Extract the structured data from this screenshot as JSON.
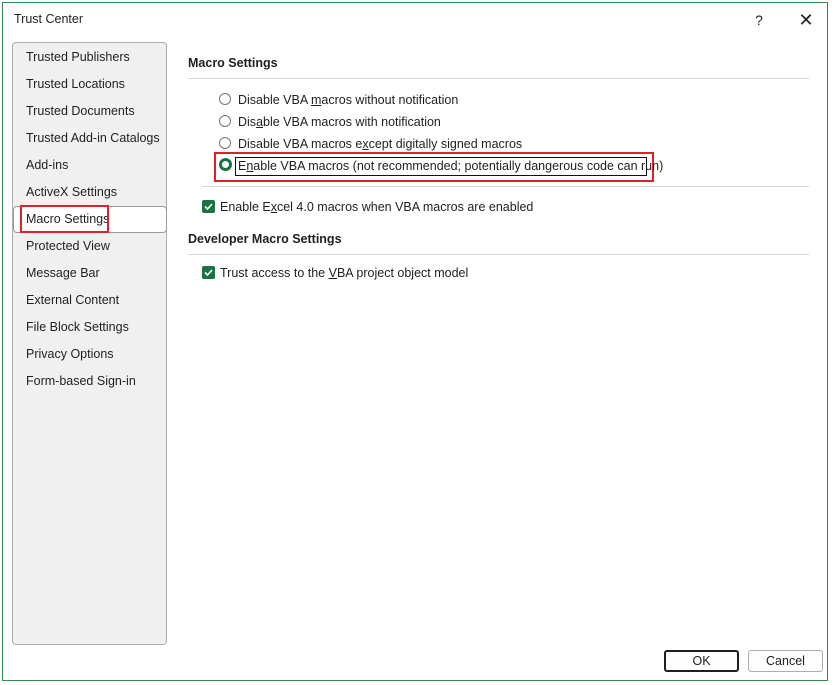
{
  "window": {
    "title": "Trust Center",
    "help_label": "?",
    "close_label": "✕"
  },
  "sidebar": {
    "items": [
      {
        "label": "Trusted Publishers"
      },
      {
        "label": "Trusted Locations"
      },
      {
        "label": "Trusted Documents"
      },
      {
        "label": "Trusted Add-in Catalogs"
      },
      {
        "label": "Add-ins"
      },
      {
        "label": "ActiveX Settings"
      },
      {
        "label": "Macro Settings",
        "selected": true
      },
      {
        "label": "Protected View"
      },
      {
        "label": "Message Bar"
      },
      {
        "label": "External Content"
      },
      {
        "label": "File Block Settings"
      },
      {
        "label": "Privacy Options"
      },
      {
        "label": "Form-based Sign-in"
      }
    ]
  },
  "macro_settings": {
    "title": "Macro Settings",
    "options": {
      "opt1": {
        "pre": "Disable VBA ",
        "u": "m",
        "post": "acros without notification",
        "selected": false
      },
      "opt2": {
        "pre": "Dis",
        "u": "a",
        "post": "ble VBA macros with notification",
        "selected": false
      },
      "opt3": {
        "pre": "Disable VBA macros e",
        "u": "x",
        "post": "cept digitally signed macros",
        "selected": false
      },
      "opt4": {
        "pre": "E",
        "u": "n",
        "post": "able VBA macros (not recommended; potentially dangerous code can run)",
        "selected": true
      }
    },
    "excel4": {
      "pre": "Enable E",
      "u": "x",
      "post": "cel 4.0 macros when VBA macros are enabled",
      "checked": true
    }
  },
  "developer": {
    "title": "Developer Macro Settings",
    "trust_vba": {
      "pre": "Trust access to the ",
      "u": "V",
      "post": "BA project object model",
      "checked": true
    }
  },
  "buttons": {
    "ok": "OK",
    "cancel": "Cancel"
  },
  "colors": {
    "accent_green": "#1e7145",
    "highlight_red": "#d9242b"
  }
}
